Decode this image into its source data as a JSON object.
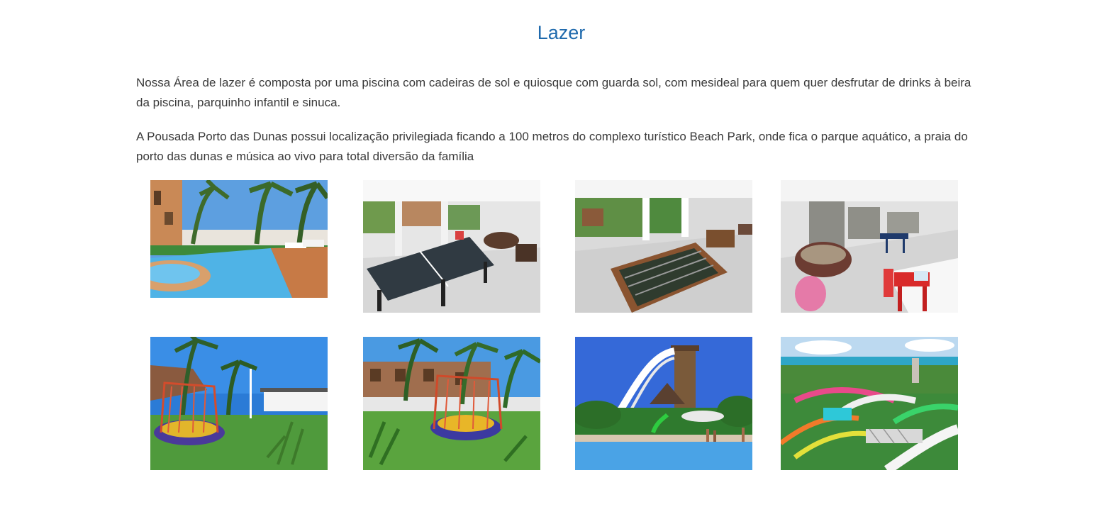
{
  "section": {
    "title": "Lazer",
    "paragraphs": [
      "Nossa Área de lazer é composta por uma piscina com cadeiras de sol e quiosque com guarda sol, com mesideal para quem quer desfrutar de drinks à beira da piscina, parquinho infantil e sinuca.",
      "A Pousada Porto das Dunas possui localização privilegiada ficando a 100 metros do complexo turístico Beach Park, onde fica o parque aquático, a praia do porto das dunas e música ao vivo para total diversão da família"
    ]
  },
  "gallery": {
    "photos": [
      {
        "subject": "swimming-pool"
      },
      {
        "subject": "ping-pong-table-room"
      },
      {
        "subject": "foosball-table-room"
      },
      {
        "subject": "play-room-with-kids-table"
      },
      {
        "subject": "playground-trampoline"
      },
      {
        "subject": "playground-trampoline-2"
      },
      {
        "subject": "water-park-slide-tower"
      },
      {
        "subject": "water-park-aerial"
      }
    ]
  }
}
